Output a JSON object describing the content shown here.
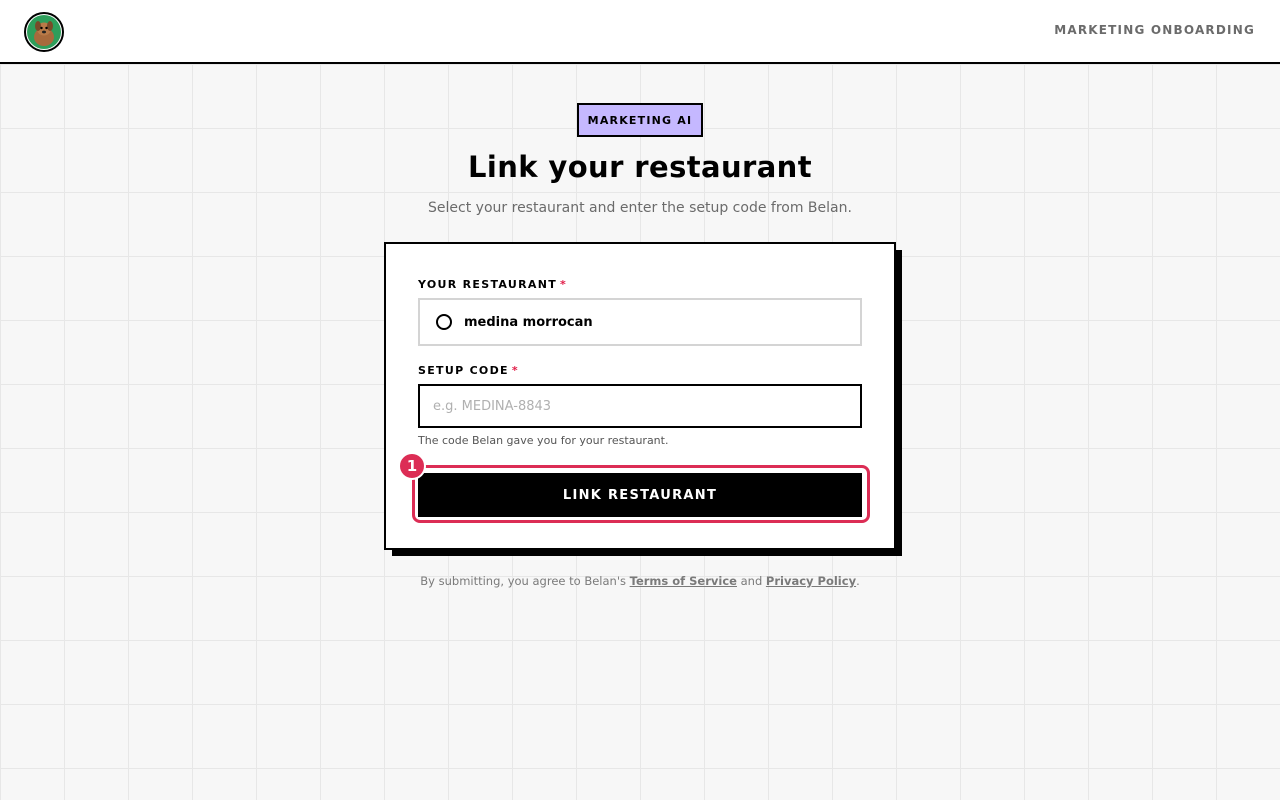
{
  "header": {
    "logo_icon": "dog-avatar-icon",
    "nav_link": "MARKETING ONBOARDING"
  },
  "hero": {
    "badge": "MARKETING AI",
    "title": "Link your restaurant",
    "subtitle": "Select your restaurant and enter the setup code from Belan."
  },
  "form": {
    "restaurant_label": "YOUR RESTAURANT",
    "required_mark": "*",
    "restaurant_option": "medina morrocan",
    "code_label": "SETUP CODE",
    "code_placeholder": "e.g. MEDINA-8843",
    "code_value": "",
    "code_help": "The code Belan gave you for your restaurant.",
    "submit_label": "LINK RESTAURANT",
    "marker_number": "1"
  },
  "footer": {
    "prefix": "By submitting, you agree to Belan's",
    "terms": "Terms of Service",
    "and": "and",
    "privacy": "Privacy Policy",
    "suffix": "."
  },
  "colors": {
    "accent": "#dc2d55",
    "badge_bg": "#c5b8ff",
    "required": "#e11d48"
  }
}
